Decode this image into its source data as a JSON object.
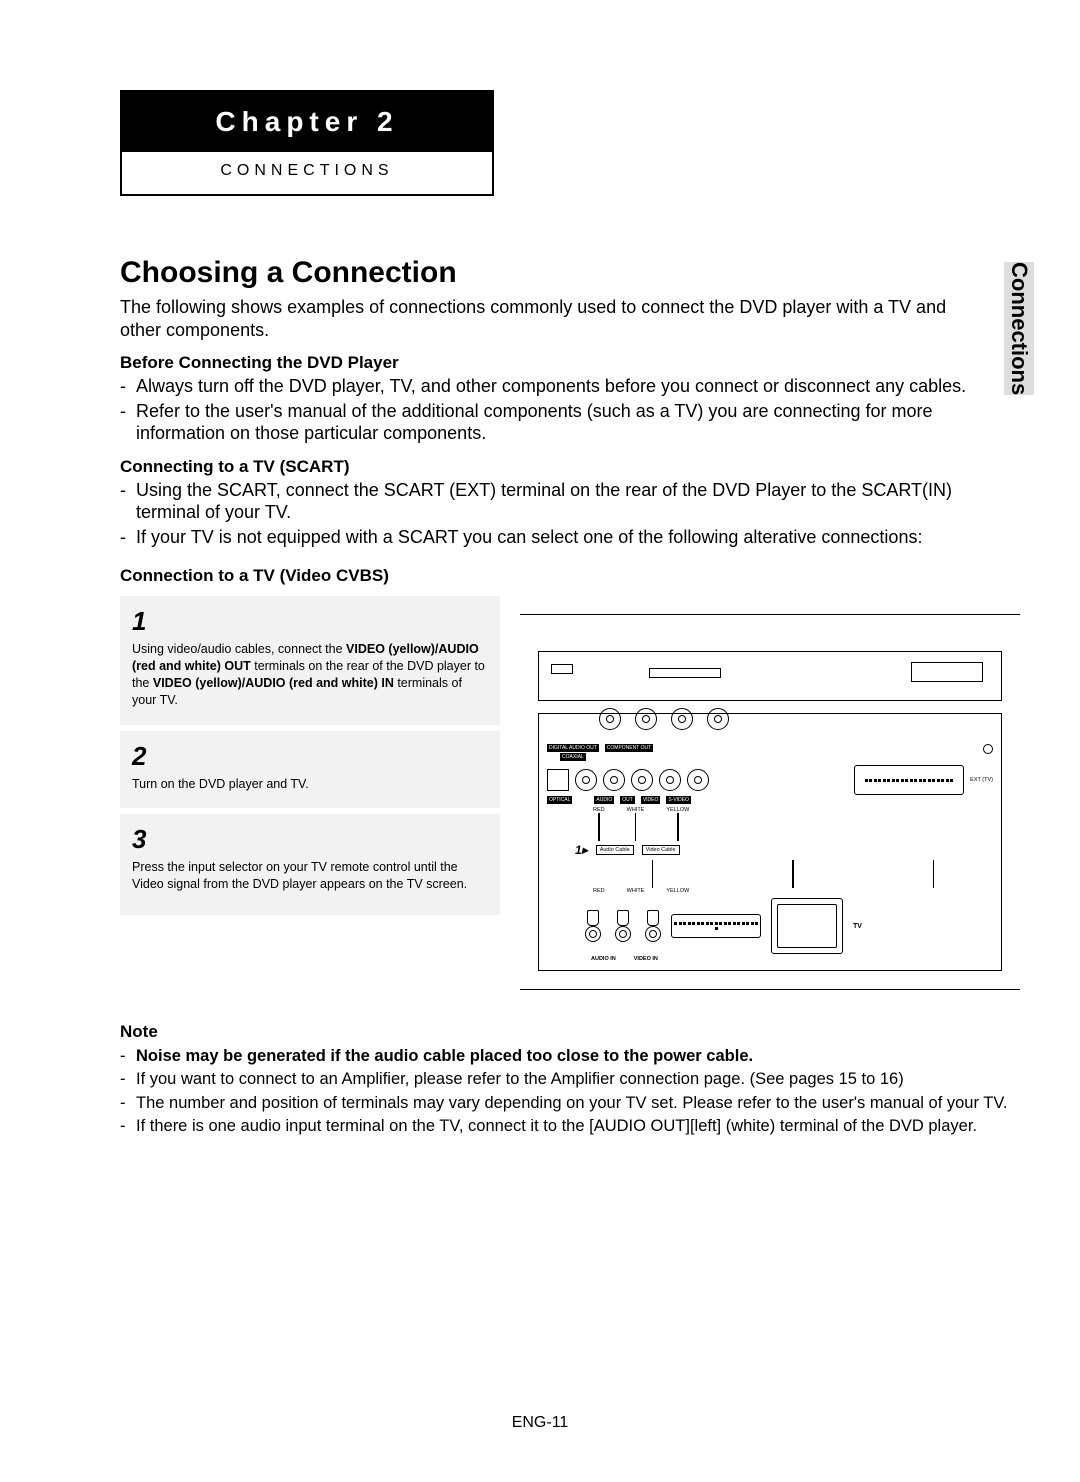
{
  "chapter": {
    "title": "Chapter 2",
    "subtitle": "CONNECTIONS"
  },
  "side_tab": "Connections",
  "section_title": "Choosing a Connection",
  "intro": "The following shows examples of connections commonly used to connect the DVD player with a TV and other components.",
  "before": {
    "heading": "Before Connecting the DVD Player",
    "items": [
      "Always turn off the DVD player, TV, and other components before you connect or disconnect any cables.",
      "Refer to the user's manual of the additional components (such as a TV) you are connecting for more information on those particular components."
    ]
  },
  "scart": {
    "heading": "Connecting to a TV (SCART)",
    "items": [
      "Using the SCART, connect the SCART (EXT) terminal on the rear of the DVD Player to the SCART(IN) terminal of your TV.",
      "If your TV is not equipped with a SCART you can select one of the following alterative connections:"
    ]
  },
  "cvbs_heading": "Connection to a TV (Video CVBS)",
  "steps": [
    {
      "num": "1",
      "text_pre": "Using video/audio cables, connect the ",
      "bold1": "VIDEO (yellow)/AUDIO (red and white) OUT",
      "text_mid": " terminals on the rear of the DVD player to the ",
      "bold2": "VIDEO (yellow)/AUDIO (red and white) IN",
      "text_post": " terminals of your TV."
    },
    {
      "num": "2",
      "text": "Turn on the DVD player and TV."
    },
    {
      "num": "3",
      "text": "Press the input selector on your TV remote control until the Video signal from the DVD player appears on the TV screen."
    }
  ],
  "diagram": {
    "labels": {
      "digital_audio_out": "DIGITAL AUDIO OUT",
      "coaxial": "COAXIAL",
      "component_out": "COMPONENT OUT",
      "optical": "OPTICAL",
      "audio": "AUDIO",
      "out": "OUT",
      "video": "VIDEO",
      "svideo": "S-VIDEO",
      "ext_tv": "EXT (TV)",
      "red": "RED",
      "white": "WHITE",
      "yellow": "YELLOW",
      "audio_cable": "Audio Cable",
      "video_cable": "Video Cable",
      "audio_in": "AUDIO IN",
      "video_in": "VIDEO IN",
      "tv": "TV",
      "marker": "1▸"
    }
  },
  "notes": {
    "heading": "Note",
    "bold_item": "Noise may be generated if the audio cable placed too close to the power cable.",
    "items": [
      "If you want to connect to an Amplifier, please refer to the Amplifier connection page. (See pages 15 to 16)",
      "The number and position of terminals may vary depending on your TV set. Please refer to the user's manual of your TV.",
      "If there is one audio input terminal on the TV, connect it to the [AUDIO OUT][left] (white) terminal of the DVD player."
    ]
  },
  "page_number": "ENG-11"
}
